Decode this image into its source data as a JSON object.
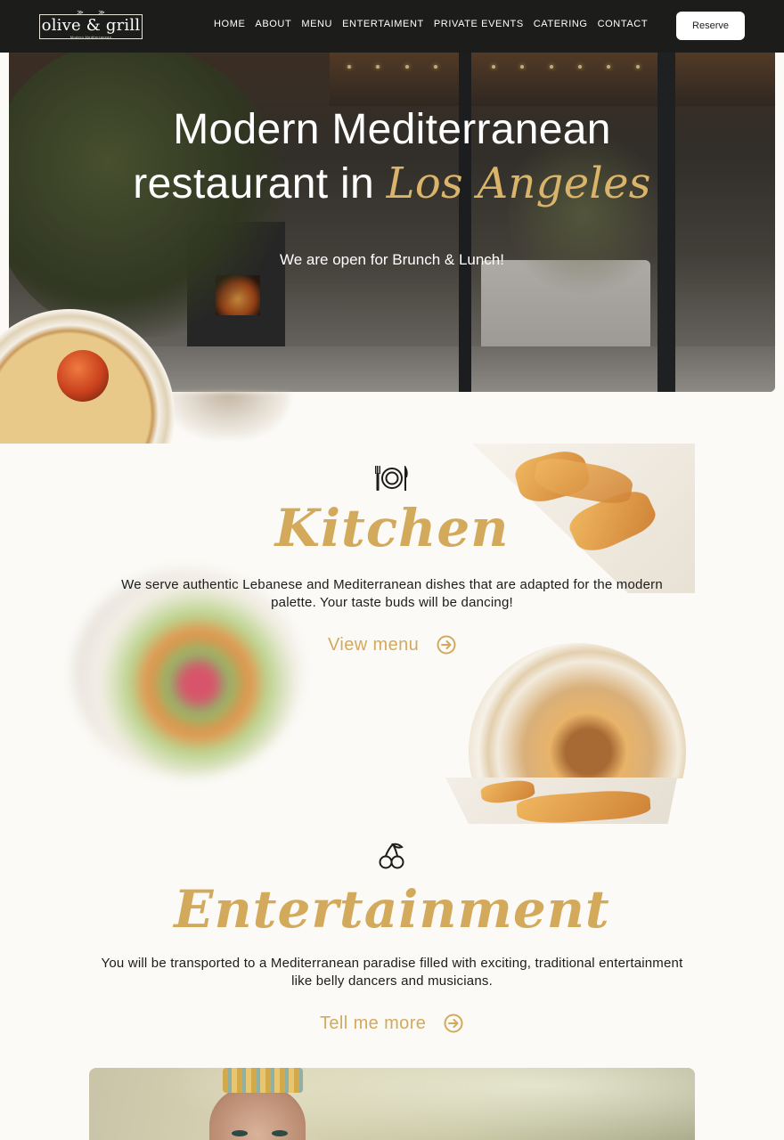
{
  "nav": {
    "logo_main": "olive & grill",
    "logo_sub": "Modern Mediterranean",
    "items": [
      "HOME",
      "ABOUT",
      "MENU",
      "ENTERTAIMENT",
      "PRIVATE EVENTS",
      "CATERING",
      "CONTACT"
    ],
    "reserve_label": "Reserve"
  },
  "hero": {
    "title_line1": "Modern Mediterranean",
    "title_line2_plain": "restaurant in",
    "title_line2_script": "Los Angeles",
    "subtitle": "We are open for Brunch & Lunch!"
  },
  "kitchen": {
    "icon": "plate-fork-knife-icon",
    "title": "Kitchen",
    "text_line1": "We serve authentic Lebanese and Mediterranean dishes that are adapted for the modern",
    "text_line2": "palette. Your taste buds will be dancing!",
    "cta_label": "View menu"
  },
  "entertainment": {
    "icon": "cherries-icon",
    "title": "Entertainment",
    "text_line1": "You will be transported to a Mediterranean paradise filled with exciting, traditional entertainment",
    "text_line2": "like belly dancers and musicians.",
    "cta_label": "Tell me more"
  },
  "colors": {
    "nav_bg": "#1c1c1a",
    "page_bg": "#fbfaf6",
    "accent_gold": "#d3aa5c",
    "text": "#1c1c1c"
  }
}
